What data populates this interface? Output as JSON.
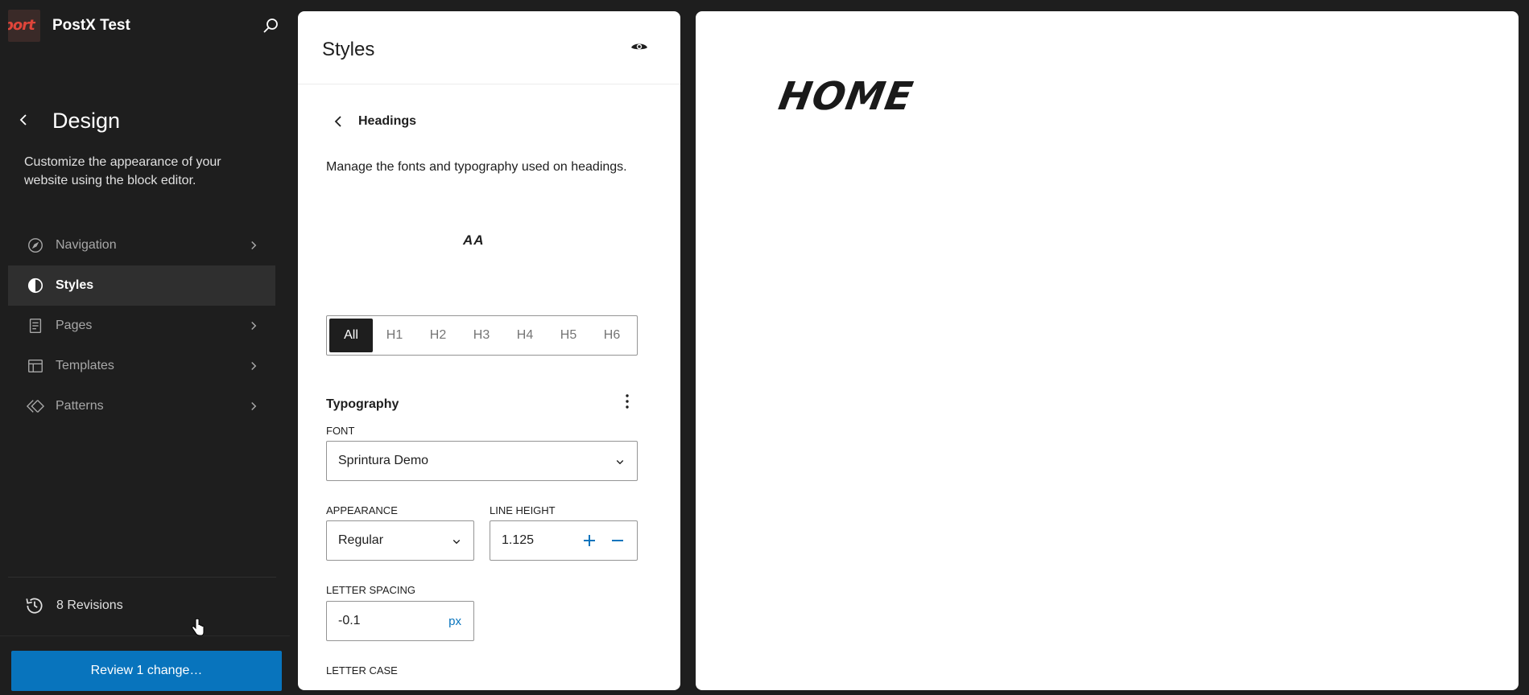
{
  "site": {
    "title": "PostX Test",
    "logo_text": "port"
  },
  "sidebar": {
    "heading": "Design",
    "description": "Customize the appearance of your website using the block editor.",
    "items": [
      {
        "label": "Navigation",
        "icon": "compass-icon",
        "active": false
      },
      {
        "label": "Styles",
        "icon": "half-circle-icon",
        "active": true
      },
      {
        "label": "Pages",
        "icon": "page-icon",
        "active": false
      },
      {
        "label": "Templates",
        "icon": "layout-icon",
        "active": false
      },
      {
        "label": "Patterns",
        "icon": "diamond-icon",
        "active": false
      }
    ],
    "revisions_label": "8 Revisions",
    "review_label": "Review 1 change…"
  },
  "styles_panel": {
    "title": "Styles",
    "section_title": "Headings",
    "section_desc": "Manage the fonts and typography used on headings.",
    "preview_text": "AA",
    "levels": [
      "All",
      "H1",
      "H2",
      "H3",
      "H4",
      "H5",
      "H6"
    ],
    "active_level": "All",
    "typography_title": "Typography",
    "font_label": "FONT",
    "font_value": "Sprintura Demo",
    "appearance_label": "APPEARANCE",
    "appearance_value": "Regular",
    "line_height_label": "LINE HEIGHT",
    "line_height_value": "1.125",
    "letter_spacing_label": "LETTER SPACING",
    "letter_spacing_value": "-0.1",
    "letter_spacing_unit": "px",
    "letter_case_label": "LETTER CASE"
  },
  "canvas": {
    "heading": "HOME"
  },
  "colors": {
    "accent": "#0874bd",
    "sidebar_bg": "#1e1e1e",
    "active_item_bg": "#2f2f2f"
  }
}
